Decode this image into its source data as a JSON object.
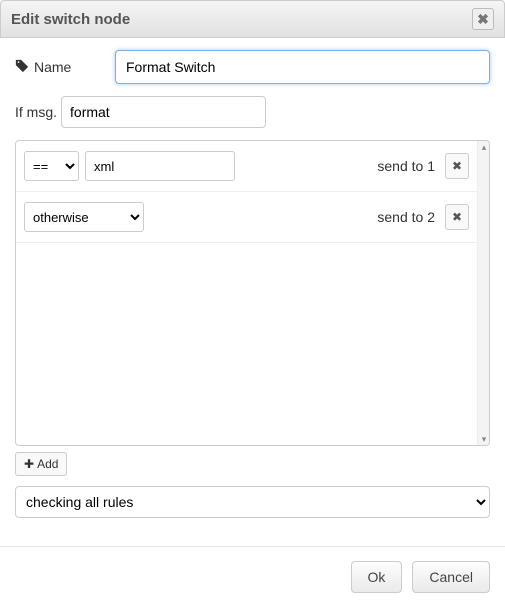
{
  "dialog": {
    "title": "Edit switch node"
  },
  "form": {
    "name_label": "Name",
    "name_value": "Format Switch",
    "ifmsg_label": "If msg.",
    "ifmsg_value": "format"
  },
  "rules": [
    {
      "op": "==",
      "value": "xml",
      "send_prefix": "send to",
      "index": "1"
    },
    {
      "op": "otherwise",
      "value": "",
      "send_prefix": "send to",
      "index": "2"
    }
  ],
  "add_button_label": "Add",
  "mode_value": "checking all rules",
  "footer": {
    "ok": "Ok",
    "cancel": "Cancel"
  }
}
